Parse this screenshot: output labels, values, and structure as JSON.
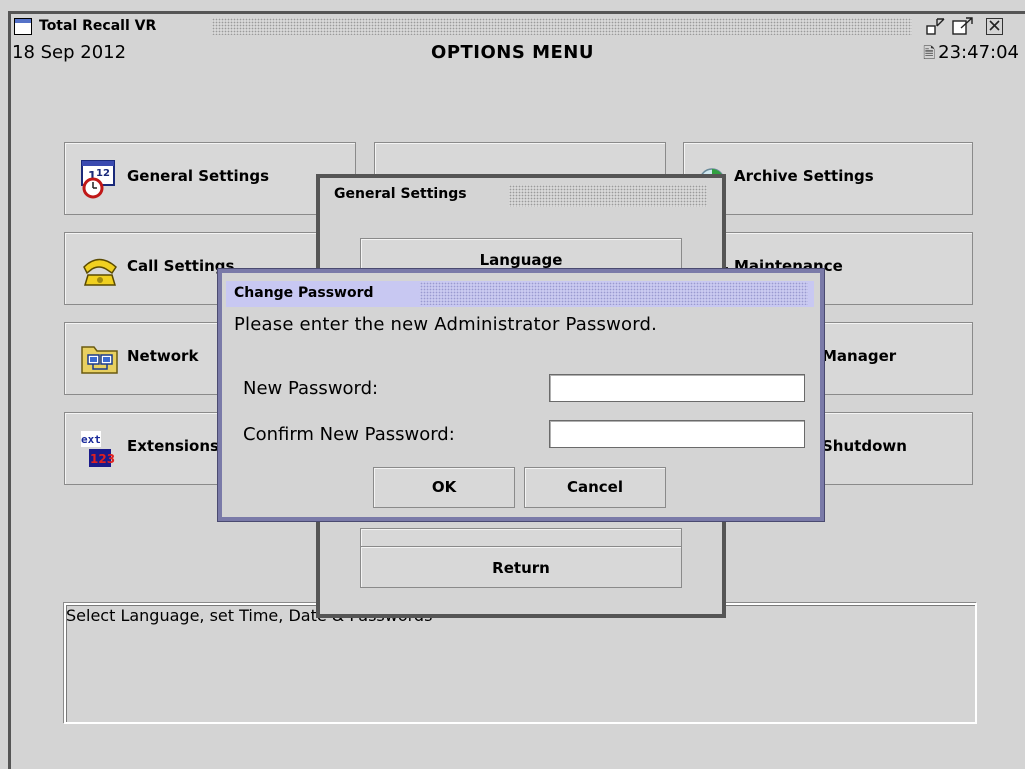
{
  "window": {
    "title": "Total Recall VR"
  },
  "header": {
    "date": "18 Sep 2012",
    "title": "OPTIONS MENU",
    "time": "23:47:04"
  },
  "menu": {
    "general": "General Settings",
    "call": "Call Settings",
    "network": "Network",
    "extensions": "Extensions",
    "archive": "Archive Settings",
    "maintenance": "Maintenance",
    "manager": "Manager",
    "shutdown": "Shutdown"
  },
  "description": "Select Language, set Time, Date & Passwords",
  "general_dialog": {
    "title": "General Settings",
    "buttons": {
      "language": "Language",
      "return": "Return"
    }
  },
  "password_dialog": {
    "title": "Change Password",
    "prompt": "Please enter the new Administrator Password.",
    "new_label": "New Password:",
    "confirm_label": "Confirm New Password:",
    "new_value": "",
    "confirm_value": "",
    "ok": "OK",
    "cancel": "Cancel"
  },
  "icons": {
    "window": "window-icon",
    "minimize": "minimize-icon",
    "maximize": "maximize-icon",
    "close": "close-icon",
    "clock_lock": "lock-icon",
    "general": "calendar-clock-icon",
    "call": "telephone-icon",
    "network": "network-folder-icon",
    "extensions": "extension-icon",
    "archive": "archive-disc-icon",
    "maintenance": "maintenance-icon"
  },
  "colors": {
    "background": "#d4d4d4",
    "dialog_title_bg": "#c8c8f2",
    "dialog_border": "#7a7aa8"
  }
}
